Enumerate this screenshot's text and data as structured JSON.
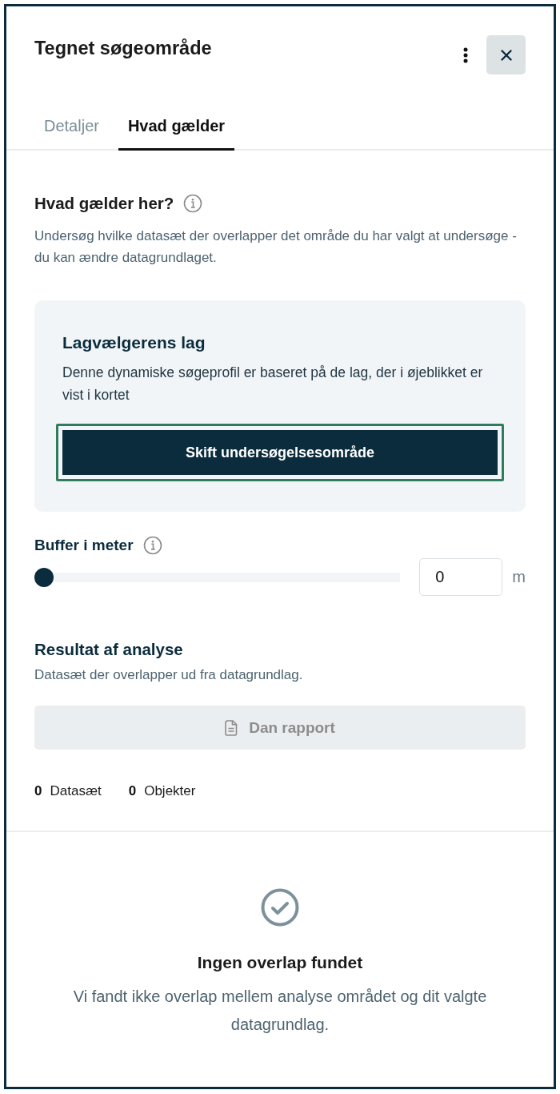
{
  "panel": {
    "title": "Tegnet søgeområde"
  },
  "tabs": [
    {
      "label": "Detaljer",
      "selected": false
    },
    {
      "label": "Hvad gælder",
      "selected": true
    }
  ],
  "intro": {
    "heading": "Hvad gælder her?",
    "description": "Undersøg hvilke datasæt der overlapper det område du har valgt at undersøge - du kan ændre datagrundlaget."
  },
  "layer_card": {
    "heading": "Lagvælgerens lag",
    "description": "Denne dynamiske søgeprofil er baseret på de lag, der i øjeblikket er vist i kortet",
    "button": {
      "label": "Skift undersøgelsesområde",
      "focused": true
    }
  },
  "buffer": {
    "label": "Buffer i meter",
    "level": 0,
    "value": "0",
    "unit": "m"
  },
  "results": {
    "heading": "Resultat af analyse",
    "description": "Datasæt der overlapper ud fra datagrundlag.",
    "report_button": {
      "label": "Dan rapport",
      "disabled": true
    },
    "counts": [
      {
        "value": "0",
        "label": "Datasæt"
      },
      {
        "value": "0",
        "label": "Objekter"
      }
    ]
  },
  "empty_state": {
    "title": "Ingen overlap fundet",
    "message": "Vi fandt ikke overlap mellem analyse området og dit valgte datagrundlag."
  }
}
